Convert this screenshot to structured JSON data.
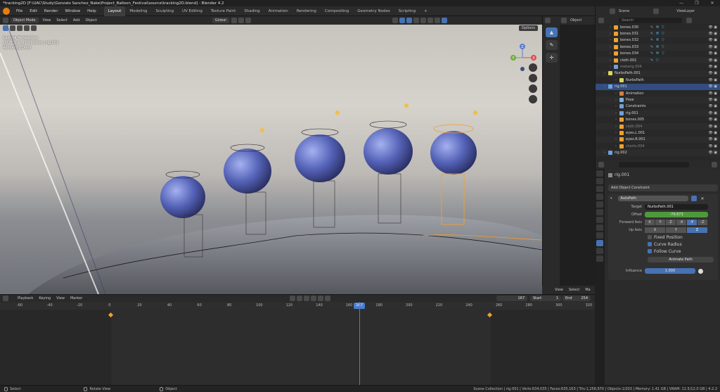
{
  "window": {
    "title": "*tracking2D [F:\\UAC\\Study\\Gonzalo Sanchez_Nake\\Project_Balloon_Festival\\source\\tracking2D.blend] - Blender 4.2",
    "controls": [
      "—",
      "❐",
      "✕"
    ]
  },
  "menu": {
    "items": [
      "File",
      "Edit",
      "Render",
      "Window",
      "Help"
    ],
    "workspaces": [
      "Layout",
      "Modeling",
      "Sculpting",
      "UV Editing",
      "Texture Paint",
      "Shading",
      "Animation",
      "Rendering",
      "Compositing",
      "Geometry Nodes",
      "Scripting",
      "+"
    ],
    "active_workspace": "Layout",
    "scene_label": "Scene",
    "view_layer_label": "ViewLayer"
  },
  "viewport_header": {
    "mode": "Object Mode",
    "items": [
      "View",
      "Select",
      "Add",
      "Object"
    ],
    "orientation": "Global",
    "options": "Options"
  },
  "viewport_overlay": {
    "line1": "Camera Perspective",
    "line2": "(167) Scene Collection | rig.001",
    "line3": "Rendering Done"
  },
  "nav_gizmo": {
    "labels": [
      "Z",
      "Y",
      "X"
    ]
  },
  "side_panel_header": {
    "object_label": "Object",
    "view": "View",
    "select": "Select",
    "marker": "Ma"
  },
  "outliner": {
    "search_placeholder": "Search",
    "rows": [
      {
        "name": "bones.030",
        "indent": 2,
        "icon": "mesh",
        "mods": "✎ ⚒ ▽",
        "selected": false,
        "dim": false
      },
      {
        "name": "bones.031",
        "indent": 2,
        "icon": "mesh",
        "mods": "✎ ⚒ ▽",
        "selected": false,
        "dim": false
      },
      {
        "name": "bones.032",
        "indent": 2,
        "icon": "mesh",
        "mods": "✎ ⚒ ▽",
        "selected": false,
        "dim": false
      },
      {
        "name": "bones.033",
        "indent": 2,
        "icon": "mesh",
        "mods": "✎ ⚒ ▽",
        "selected": false,
        "dim": false
      },
      {
        "name": "bones.034",
        "indent": 2,
        "icon": "mesh",
        "mods": "✎ ⚒ ▽",
        "selected": false,
        "dim": false
      },
      {
        "name": "cloth.001",
        "indent": 2,
        "icon": "mesh",
        "mods": "✎ ▽",
        "selected": false,
        "dim": false
      },
      {
        "name": "metarig.004",
        "indent": 2,
        "icon": "armature",
        "mods": "",
        "selected": false,
        "dim": true
      },
      {
        "name": "NurbsPath.001",
        "indent": 1,
        "icon": "curve",
        "mods": "",
        "selected": false,
        "dim": false
      },
      {
        "name": "NurbsPath",
        "indent": 3,
        "icon": "curve",
        "mods": "",
        "selected": false,
        "dim": false
      },
      {
        "name": "rig.001",
        "indent": 1,
        "icon": "armature",
        "mods": "",
        "selected": true,
        "dim": false
      },
      {
        "name": "Animation",
        "indent": 3,
        "icon": "anim",
        "mods": "",
        "selected": false,
        "dim": false
      },
      {
        "name": "Pose",
        "indent": 3,
        "icon": "pose",
        "mods": "",
        "selected": false,
        "dim": false
      },
      {
        "name": "Constraints",
        "indent": 3,
        "icon": "constraint",
        "mods": "",
        "selected": false,
        "dim": false
      },
      {
        "name": "rig.001",
        "indent": 3,
        "icon": "armature",
        "mods": "",
        "selected": false,
        "dim": false
      },
      {
        "name": "bones.005",
        "indent": 3,
        "icon": "mesh",
        "mods": "",
        "selected": false,
        "dim": false
      },
      {
        "name": "cloth.004",
        "indent": 3,
        "icon": "mesh",
        "mods": "",
        "selected": false,
        "dim": true
      },
      {
        "name": "eyes.L.001",
        "indent": 3,
        "icon": "mesh",
        "mods": "",
        "selected": false,
        "dim": false
      },
      {
        "name": "eyes.R.001",
        "indent": 3,
        "icon": "mesh",
        "mods": "",
        "selected": false,
        "dim": false
      },
      {
        "name": "shorts.004",
        "indent": 3,
        "icon": "mesh",
        "mods": "",
        "selected": false,
        "dim": true
      },
      {
        "name": "rig.002",
        "indent": 1,
        "icon": "armature",
        "mods": "",
        "selected": false,
        "dim": false
      }
    ]
  },
  "properties": {
    "object_name": "rig.001",
    "add_constraint": "Add Object Constraint",
    "constraint_name": "AutoPath",
    "target_label": "Target",
    "target_value": "NurbsPath.001",
    "offset_label": "Offset",
    "offset_value": "-79.673",
    "forward_axis_label": "Forward Axis",
    "forward_axis": [
      "X",
      "Y",
      "Z",
      "-X",
      "-Y",
      "-Z"
    ],
    "forward_axis_active": "-Y",
    "up_axis_label": "Up Axis",
    "up_axis": [
      "X",
      "Y",
      "Z"
    ],
    "up_axis_active": "Z",
    "fixed_position": "Fixed Position",
    "curve_radius": "Curve Radius",
    "follow_curve": "Follow Curve",
    "animate_path": "Animate Path",
    "influence_label": "Influence",
    "influence_value": "1.000"
  },
  "timeline": {
    "menu": [
      "Playback",
      "Keying",
      "View",
      "Marker"
    ],
    "current_frame": "167",
    "start_label": "Start",
    "start_value": "1",
    "end_label": "End",
    "end_value": "254",
    "ticks": [
      "-60",
      "-40",
      "-20",
      "0",
      "20",
      "40",
      "60",
      "80",
      "100",
      "120",
      "140",
      "160",
      "180",
      "200",
      "220",
      "240",
      "260",
      "280",
      "300",
      "320"
    ]
  },
  "statusbar": {
    "select": "Select",
    "rotate": "Rotate View",
    "object": "Object",
    "stats": "Scene Collection | rig.001 | Verts:634,035 | Faces:635,163 | Tris:1,256,970 | Objects:1/203 | Memory: 1.41 GB | VRAM: 11.5/12.0 GB | 4.2.2"
  },
  "colors": {
    "accent": "#4772b3",
    "selection": "#334d80",
    "orange": "#f0a030",
    "playhead": "#4a7cd0"
  }
}
